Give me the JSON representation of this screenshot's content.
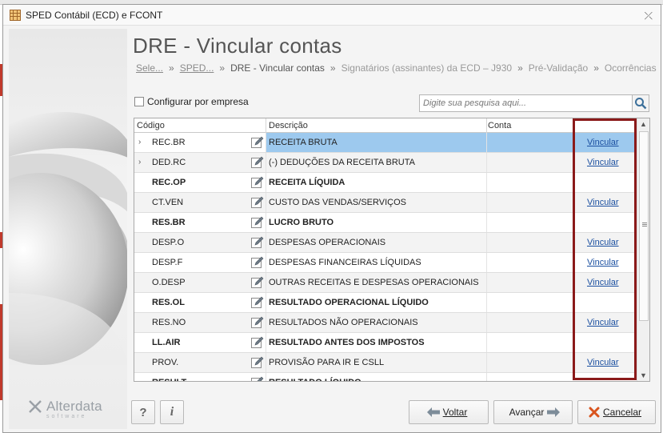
{
  "window": {
    "title": "SPED Contábil (ECD) e FCONT",
    "close_symbol": "⤫"
  },
  "brand": {
    "name": "Alterdata",
    "tagline": "software"
  },
  "page": {
    "title": "DRE - Vincular contas",
    "breadcrumb": [
      {
        "label": "Sele...",
        "type": "link"
      },
      {
        "label": "SPED...",
        "type": "link"
      },
      {
        "label": "DRE - Vincular contas",
        "type": "current"
      },
      {
        "label": "Signatários (assinantes) da ECD – J930",
        "type": "future"
      },
      {
        "label": "Pré-Validação",
        "type": "future"
      },
      {
        "label": "Ocorrências",
        "type": "future"
      }
    ]
  },
  "config": {
    "label": "Configurar por empresa",
    "checked": false
  },
  "search": {
    "placeholder": "Digite sua pesquisa aqui..."
  },
  "grid": {
    "headers": {
      "codigo": "Código",
      "descricao": "Descrição",
      "conta": "Conta"
    },
    "rows": [
      {
        "expand": "›",
        "code": "REC.BR",
        "desc": "RECEITA BRUTA",
        "bold": false,
        "link": "Vincular",
        "selected": true
      },
      {
        "expand": "›",
        "code": "DED.RC",
        "desc": "(-) DEDUÇÕES DA RECEITA BRUTA",
        "bold": false,
        "link": "Vincular",
        "selected": false
      },
      {
        "expand": "",
        "code": "REC.OP",
        "desc": "RECEITA LÍQUIDA",
        "bold": true,
        "link": "",
        "selected": false
      },
      {
        "expand": "",
        "code": "CT.VEN",
        "desc": "CUSTO DAS VENDAS/SERVIÇOS",
        "bold": false,
        "link": "Vincular",
        "selected": false
      },
      {
        "expand": "",
        "code": "RES.BR",
        "desc": "LUCRO BRUTO",
        "bold": true,
        "link": "",
        "selected": false
      },
      {
        "expand": "",
        "code": "DESP.O",
        "desc": "DESPESAS OPERACIONAIS",
        "bold": false,
        "link": "Vincular",
        "selected": false
      },
      {
        "expand": "",
        "code": "DESP.F",
        "desc": "DESPESAS FINANCEIRAS LÍQUIDAS",
        "bold": false,
        "link": "Vincular",
        "selected": false
      },
      {
        "expand": "",
        "code": "O.DESP",
        "desc": "OUTRAS RECEITAS E DESPESAS OPERACIONAIS",
        "bold": false,
        "link": "Vincular",
        "selected": false
      },
      {
        "expand": "",
        "code": "RES.OL",
        "desc": "RESULTADO OPERACIONAL LÍQUIDO",
        "bold": true,
        "link": "",
        "selected": false
      },
      {
        "expand": "",
        "code": "RES.NO",
        "desc": "RESULTADOS NÃO OPERACIONAIS",
        "bold": false,
        "link": "Vincular",
        "selected": false
      },
      {
        "expand": "",
        "code": "LL.AIR",
        "desc": "RESULTADO ANTES DOS IMPOSTOS",
        "bold": true,
        "link": "",
        "selected": false
      },
      {
        "expand": "",
        "code": "PROV.",
        "desc": "PROVISÃO PARA IR E CSLL",
        "bold": false,
        "link": "Vincular",
        "selected": false
      },
      {
        "expand": "",
        "code": "RESULT",
        "desc": "RESULTADO LÍQUIDO",
        "bold": true,
        "link": "",
        "selected": false
      }
    ]
  },
  "buttons": {
    "help": "?",
    "info": "i",
    "voltar": "Voltar",
    "avancar": "Avançar",
    "cancelar": "Cancelar"
  },
  "colors": {
    "selection": "#9dc9ee",
    "link": "#1a4fa0",
    "highlight_border": "#8b1a1a",
    "cancel_icon": "#d9541e",
    "arrow_icon": "#7d8c99"
  }
}
